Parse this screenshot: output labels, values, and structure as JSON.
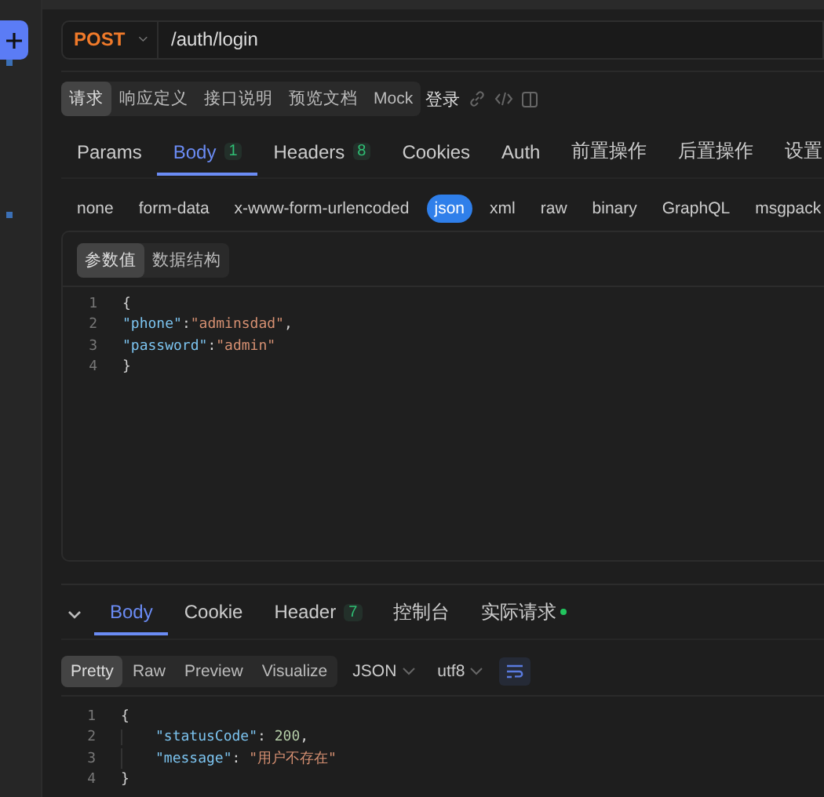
{
  "url_bar": {
    "method": "POST",
    "url": "/auth/login"
  },
  "view_tabs": [
    {
      "label": "请求",
      "selected": true
    },
    {
      "label": "响应定义",
      "selected": false
    },
    {
      "label": "接口说明",
      "selected": false
    },
    {
      "label": "预览文档",
      "selected": false
    },
    {
      "label": "Mock",
      "selected": false
    }
  ],
  "request_name": "登录",
  "param_tabs": [
    {
      "label": "Params",
      "selected": false
    },
    {
      "label": "Body",
      "count": "1",
      "selected": true
    },
    {
      "label": "Headers",
      "count": "8",
      "selected": false
    },
    {
      "label": "Cookies",
      "selected": false
    },
    {
      "label": "Auth",
      "selected": false
    },
    {
      "label": "前置操作",
      "selected": false
    },
    {
      "label": "后置操作",
      "selected": false
    },
    {
      "label": "设置",
      "selected": false
    }
  ],
  "body_types": [
    {
      "label": "none",
      "selected": false
    },
    {
      "label": "form-data",
      "selected": false
    },
    {
      "label": "x-www-form-urlencoded",
      "selected": false
    },
    {
      "label": "json",
      "selected": true
    },
    {
      "label": "xml",
      "selected": false
    },
    {
      "label": "raw",
      "selected": false
    },
    {
      "label": "binary",
      "selected": false
    },
    {
      "label": "GraphQL",
      "selected": false
    },
    {
      "label": "msgpack",
      "selected": false
    }
  ],
  "editor_tabs": [
    {
      "label": "参数值",
      "selected": true
    },
    {
      "label": "数据结构",
      "selected": false
    }
  ],
  "request_code": [
    {
      "number": "1",
      "tokens": [
        {
          "kind": "punct",
          "text": "{"
        }
      ]
    },
    {
      "number": "2",
      "tokens": [
        {
          "kind": "key",
          "text": "\"phone\""
        },
        {
          "kind": "punct",
          "text": ":"
        },
        {
          "kind": "string",
          "text": "\"adminsdad\""
        },
        {
          "kind": "punct",
          "text": ","
        }
      ]
    },
    {
      "number": "3",
      "tokens": [
        {
          "kind": "key",
          "text": "\"password\""
        },
        {
          "kind": "punct",
          "text": ":"
        },
        {
          "kind": "string",
          "text": "\"admin\""
        }
      ]
    },
    {
      "number": "4",
      "tokens": [
        {
          "kind": "punct",
          "text": "}"
        }
      ]
    }
  ],
  "response_tabs": [
    {
      "label": "Body",
      "selected": true
    },
    {
      "label": "Cookie",
      "selected": false
    },
    {
      "label": "Header",
      "count": "7",
      "selected": false
    },
    {
      "label": "控制台",
      "selected": false
    },
    {
      "label": "实际请求",
      "color": "#22c55e",
      "selected": false
    }
  ],
  "view_modes": [
    {
      "label": "Pretty",
      "selected": true
    },
    {
      "label": "Raw",
      "selected": false
    },
    {
      "label": "Preview",
      "selected": false
    },
    {
      "label": "Visualize",
      "selected": false
    }
  ],
  "format_select": "JSON",
  "encoding_select": "utf8",
  "response_code": [
    {
      "number": "1",
      "indent": false,
      "tokens": [
        {
          "kind": "punct",
          "text": "{"
        }
      ]
    },
    {
      "number": "2",
      "indent": true,
      "tokens": [
        {
          "kind": "key",
          "text": "\"statusCode\""
        },
        {
          "kind": "punct",
          "text": ": "
        },
        {
          "kind": "number",
          "text": "200"
        },
        {
          "kind": "punct",
          "text": ","
        }
      ]
    },
    {
      "number": "3",
      "indent": true,
      "tokens": [
        {
          "kind": "key",
          "text": "\"message\""
        },
        {
          "kind": "punct",
          "text": ": "
        },
        {
          "kind": "string",
          "text": "\"用户不存在\""
        }
      ]
    },
    {
      "number": "4",
      "indent": false,
      "tokens": [
        {
          "kind": "punct",
          "text": "}"
        }
      ]
    }
  ]
}
